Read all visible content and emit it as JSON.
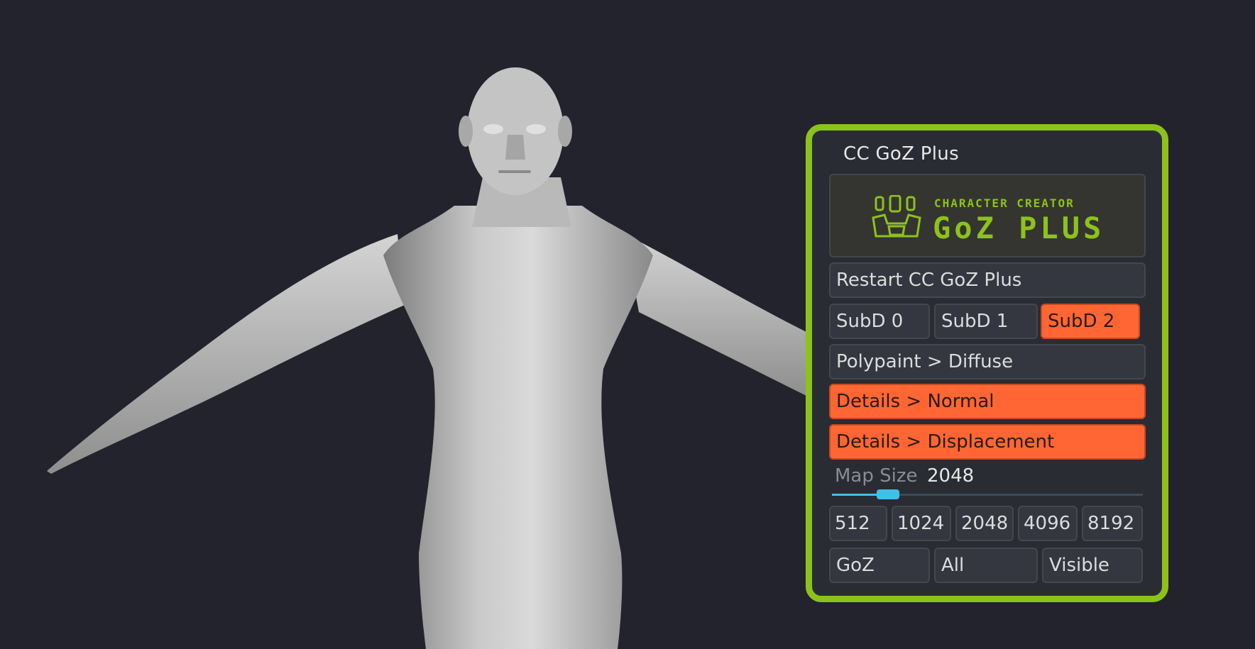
{
  "panel": {
    "title": "CC GoZ Plus",
    "logo": {
      "small_text": "CHARACTER CREATOR",
      "big_text": "GoZ PLUS",
      "accent_color": "#8cc21c"
    },
    "restart_label": "Restart CC GoZ Plus",
    "subd": [
      {
        "label": "SubD 0",
        "active": false
      },
      {
        "label": "SubD 1",
        "active": false
      },
      {
        "label": "SubD 2",
        "active": true
      }
    ],
    "polypaint_label": "Polypaint > Diffuse",
    "details_normal_label": "Details > Normal",
    "details_displacement_label": "Details > Displacement",
    "map_size": {
      "label": "Map Size",
      "value": "2048",
      "slider_fraction": 0.18
    },
    "sizes": [
      "512",
      "1024",
      "2048",
      "4096",
      "8192"
    ],
    "bottom": [
      "GoZ",
      "All",
      "Visible"
    ],
    "active_color": "#ff6633",
    "frame_color": "#8cc21c"
  }
}
